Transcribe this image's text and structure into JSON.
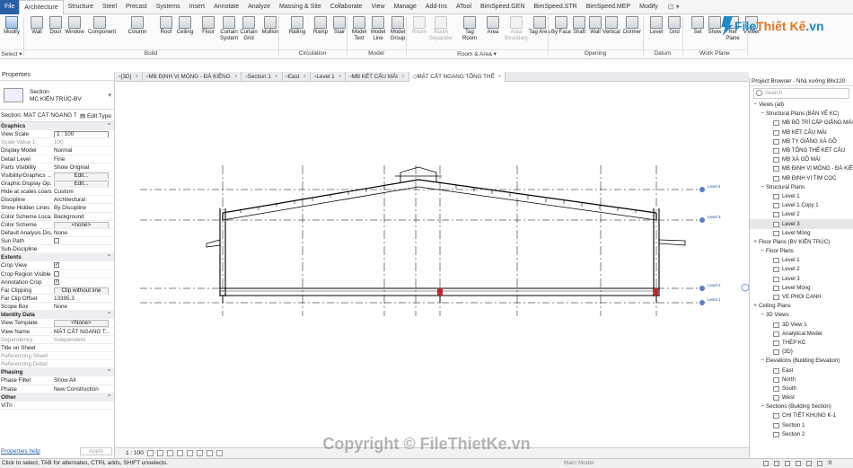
{
  "menu": {
    "tabs": [
      "File",
      "Architecture",
      "Structure",
      "Steel",
      "Precast",
      "Systems",
      "Insert",
      "Annotate",
      "Analyze",
      "Massing & Site",
      "Collaborate",
      "View",
      "Manage",
      "Add-Ins",
      "ATool",
      "BimSpeed.GEN",
      "BimSpeed.STR",
      "BimSpeed.MEP",
      "Modify"
    ],
    "active": "Architecture"
  },
  "ribbon": {
    "tools": [
      {
        "label": "Modify",
        "icon": "cursor-icon",
        "selected": true
      },
      {
        "label": "Wall",
        "icon": "wall-icon"
      },
      {
        "label": "Door",
        "icon": "door-icon"
      },
      {
        "label": "Window",
        "icon": "window-icon"
      },
      {
        "label": "Component",
        "icon": "component-icon"
      },
      {
        "label": "Column",
        "icon": "column-icon"
      },
      {
        "label": "Roof",
        "icon": "roof-icon"
      },
      {
        "label": "Ceiling",
        "icon": "ceiling-icon"
      },
      {
        "label": "Floor",
        "icon": "floor-icon"
      },
      {
        "label": "Curtain System",
        "icon": "curtain-system-icon"
      },
      {
        "label": "Curtain Grid",
        "icon": "curtain-grid-icon"
      },
      {
        "label": "Mullion",
        "icon": "mullion-icon"
      },
      {
        "label": "Railing",
        "icon": "railing-icon"
      },
      {
        "label": "Ramp",
        "icon": "ramp-icon"
      },
      {
        "label": "Stair",
        "icon": "stair-icon"
      },
      {
        "label": "Model Text",
        "icon": "model-text-icon"
      },
      {
        "label": "Model Line",
        "icon": "model-line-icon"
      },
      {
        "label": "Model Group",
        "icon": "model-group-icon"
      },
      {
        "label": "Room",
        "icon": "room-icon",
        "dim": true
      },
      {
        "label": "Room Separator",
        "icon": "room-separator-icon",
        "dim": true
      },
      {
        "label": "Tag Room",
        "icon": "tag-room-icon"
      },
      {
        "label": "Area",
        "icon": "area-icon"
      },
      {
        "label": "Area Boundary",
        "icon": "area-boundary-icon",
        "dim": true
      },
      {
        "label": "Tag Area",
        "icon": "tag-area-icon"
      },
      {
        "label": "By Face",
        "icon": "by-face-icon"
      },
      {
        "label": "Shaft",
        "icon": "shaft-icon"
      },
      {
        "label": "Wall",
        "icon": "opening-wall-icon"
      },
      {
        "label": "Vertical",
        "icon": "vertical-icon"
      },
      {
        "label": "Dormer",
        "icon": "dormer-icon"
      },
      {
        "label": "Level",
        "icon": "level-icon"
      },
      {
        "label": "Grid",
        "icon": "grid-icon"
      },
      {
        "label": "Set",
        "icon": "set-icon"
      },
      {
        "label": "Show",
        "icon": "show-icon"
      },
      {
        "label": "Ref Plane",
        "icon": "ref-plane-icon"
      },
      {
        "label": "Viewer",
        "icon": "viewer-icon"
      }
    ],
    "panels": [
      "Select ▾",
      "Build",
      "Circulation",
      "Model",
      "Room & Area ▾",
      "Opening",
      "Datum",
      "Work Plane"
    ]
  },
  "logo": {
    "text": "File",
    "text2": "Thiết Kế",
    "suffix": ".vn"
  },
  "properties": {
    "title": "Properties",
    "type_family": "Section",
    "type_name": "MC KIẾN TRÚC-BV",
    "selector": "Section: MẶT CẮT NGANG T",
    "edit_type": "Edit Type",
    "rows": [
      {
        "k": "Graphics",
        "v": "⌃",
        "group": true
      },
      {
        "k": "View Scale",
        "v": "1 : 100",
        "style": "box"
      },
      {
        "k": "Scale Value    1:",
        "v": "100",
        "gray": true
      },
      {
        "k": "Display Model",
        "v": "Normal"
      },
      {
        "k": "Detail Level",
        "v": "Fine"
      },
      {
        "k": "Parts Visibility",
        "v": "Show Original"
      },
      {
        "k": "Visibility/Graphics ...",
        "v": "Edit...",
        "style": "btn"
      },
      {
        "k": "Graphic Display Op...",
        "v": "Edit...",
        "style": "btn"
      },
      {
        "k": "Hide at scales coars...",
        "v": "Custom"
      },
      {
        "k": "Discipline",
        "v": "Architectural"
      },
      {
        "k": "Show Hidden Lines",
        "v": "By Discipline"
      },
      {
        "k": "Color Scheme Loca...",
        "v": "Background"
      },
      {
        "k": "Color Scheme",
        "v": "<none>",
        "style": "btn"
      },
      {
        "k": "Default Analysis Dis...",
        "v": "None"
      },
      {
        "k": "Sun Path",
        "v": "",
        "check": "off"
      },
      {
        "k": "Sub-Discipline",
        "v": ""
      },
      {
        "k": "Extents",
        "v": "⌃",
        "group": true
      },
      {
        "k": "Crop View",
        "v": "",
        "check": "on"
      },
      {
        "k": "Crop Region Visible",
        "v": "",
        "check": "off"
      },
      {
        "k": "Annotation Crop",
        "v": "",
        "check": "on"
      },
      {
        "k": "Far Clipping",
        "v": "Clip without line",
        "style": "btn"
      },
      {
        "k": "Far Clip Offset",
        "v": "13395.3"
      },
      {
        "k": "Scope Box",
        "v": "None"
      },
      {
        "k": "Identity Data",
        "v": "⌃",
        "group": true
      },
      {
        "k": "View Template",
        "v": "<None>",
        "style": "btn"
      },
      {
        "k": "View Name",
        "v": "MẶT CẮT NGANG T..."
      },
      {
        "k": "Dependency",
        "v": "Independent",
        "gray": true
      },
      {
        "k": "Title on Sheet",
        "v": ""
      },
      {
        "k": "Referencing Sheet",
        "v": "",
        "gray": true
      },
      {
        "k": "Referencing Detail",
        "v": "",
        "gray": true
      },
      {
        "k": "Phasing",
        "v": "⌃",
        "group": true
      },
      {
        "k": "Phase Filter",
        "v": "Show All"
      },
      {
        "k": "Phase",
        "v": "New Construction"
      },
      {
        "k": "Other",
        "v": "⌃",
        "group": true
      },
      {
        "k": "ViTri",
        "v": ""
      }
    ],
    "help": "Properties help",
    "apply": "Apply"
  },
  "view_tabs": [
    {
      "label": "{3D}",
      "active": false
    },
    {
      "label": "MB ĐỊNH VỊ MÓNG - ĐÀ KIỀNG",
      "active": false
    },
    {
      "label": "Section 1",
      "active": false
    },
    {
      "label": "East",
      "active": false
    },
    {
      "label": "Level 1",
      "active": false
    },
    {
      "label": "MB KẾT CẤU MÁI",
      "active": false
    },
    {
      "label": "MẶT CẮT NGANG TỔNG THỂ",
      "active": true
    }
  ],
  "drawing": {
    "level_labels": [
      "Level 4",
      "Level 3",
      "Level 2",
      "Level 1"
    ]
  },
  "browser": {
    "title": "Project Browser - Nhà xưởng 88x120",
    "search": "Search",
    "items": [
      {
        "label": "Views (all)",
        "indent": 0,
        "toggle": "−",
        "icon": false
      },
      {
        "label": "Structural Plans (BẢN VẼ KC)",
        "indent": 1,
        "toggle": "−",
        "icon": false
      },
      {
        "label": "MB BỐ TRÍ CẤP GIẰNG MÁI",
        "indent": 2,
        "toggle": "",
        "icon": true
      },
      {
        "label": "MB KẾT CẤU MÁI",
        "indent": 2,
        "toggle": "",
        "icon": true
      },
      {
        "label": "MB TY GIẰNG XÀ GỒ",
        "indent": 2,
        "toggle": "",
        "icon": true
      },
      {
        "label": "MB TỔNG THỂ KẾT CẤU",
        "indent": 2,
        "toggle": "",
        "icon": true
      },
      {
        "label": "MB XÀ GỒ MÁI",
        "indent": 2,
        "toggle": "",
        "icon": true
      },
      {
        "label": "MB ĐỊNH VỊ MÓNG - ĐÀ KIỀ",
        "indent": 2,
        "toggle": "",
        "icon": true
      },
      {
        "label": "MB ĐỊNH VỊ TIM CỌC",
        "indent": 2,
        "toggle": "",
        "icon": true
      },
      {
        "label": "Structural Plans",
        "indent": 1,
        "toggle": "−",
        "icon": false
      },
      {
        "label": "Level 1",
        "indent": 2,
        "toggle": "",
        "icon": true
      },
      {
        "label": "Level 1 Copy 1",
        "indent": 2,
        "toggle": "",
        "icon": true
      },
      {
        "label": "Level 2",
        "indent": 2,
        "toggle": "",
        "icon": true
      },
      {
        "label": "Level 3",
        "indent": 2,
        "toggle": "",
        "icon": true,
        "selected": true
      },
      {
        "label": "Level Móng",
        "indent": 2,
        "toggle": "",
        "icon": true
      },
      {
        "label": "Floor Plans (BV KIẾN TRÚC)",
        "indent": 0,
        "toggle": "+",
        "icon": false
      },
      {
        "label": "Floor Plans",
        "indent": 1,
        "toggle": "−",
        "icon": false
      },
      {
        "label": "Level 1",
        "indent": 2,
        "toggle": "",
        "icon": true
      },
      {
        "label": "Level 2",
        "indent": 2,
        "toggle": "",
        "icon": true
      },
      {
        "label": "Level 3",
        "indent": 2,
        "toggle": "",
        "icon": true
      },
      {
        "label": "Level Móng",
        "indent": 2,
        "toggle": "",
        "icon": true
      },
      {
        "label": "VE PHOI CANH",
        "indent": 2,
        "toggle": "",
        "icon": true
      },
      {
        "label": "Ceiling Plans",
        "indent": 0,
        "toggle": "+",
        "icon": false
      },
      {
        "label": "3D Views",
        "indent": 1,
        "toggle": "−",
        "icon": false
      },
      {
        "label": "3D View 1",
        "indent": 2,
        "toggle": "",
        "icon": true
      },
      {
        "label": "Analytical Model",
        "indent": 2,
        "toggle": "",
        "icon": true
      },
      {
        "label": "THÉP KC",
        "indent": 2,
        "toggle": "",
        "icon": true
      },
      {
        "label": "{3D}",
        "indent": 2,
        "toggle": "",
        "icon": true
      },
      {
        "label": "Elevations (Building Elevation)",
        "indent": 1,
        "toggle": "−",
        "icon": false
      },
      {
        "label": "East",
        "indent": 2,
        "toggle": "",
        "icon": true
      },
      {
        "label": "North",
        "indent": 2,
        "toggle": "",
        "icon": true
      },
      {
        "label": "South",
        "indent": 2,
        "toggle": "",
        "icon": true
      },
      {
        "label": "West",
        "indent": 2,
        "toggle": "",
        "icon": true
      },
      {
        "label": "Sections (Building Section)",
        "indent": 1,
        "toggle": "−",
        "icon": false
      },
      {
        "label": "CHI TIẾT KHUNG K-1",
        "indent": 2,
        "toggle": "",
        "icon": true
      },
      {
        "label": "Section 1",
        "indent": 2,
        "toggle": "",
        "icon": true
      },
      {
        "label": "Section 2",
        "indent": 2,
        "toggle": "",
        "icon": true
      }
    ]
  },
  "viewbar": {
    "scale": "1 : 100"
  },
  "status": {
    "message": "Click to select, TAB for alternates, CTRL adds, SHIFT unselects.",
    "model": "Main Model",
    "filter_count": ":0"
  },
  "watermark": "Copyright © FileThietKe.vn",
  "colors": {
    "accent": "#2a5fa8",
    "logo_blue": "#1e88c7",
    "logo_orange": "#e2761b",
    "beam_red": "#c0262b"
  }
}
